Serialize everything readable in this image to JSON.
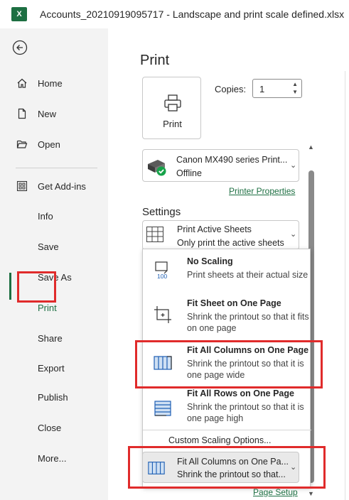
{
  "window": {
    "app_icon": "excel-icon",
    "app_icon_text": "X",
    "title": "Accounts_20210919095717 - Landscape and print scale defined.xlsx"
  },
  "sidebar": {
    "back_icon": "back-arrow-icon",
    "items": [
      {
        "label": "Home",
        "icon": "home-icon"
      },
      {
        "label": "New",
        "icon": "new-document-icon"
      },
      {
        "label": "Open",
        "icon": "folder-icon"
      },
      {
        "label": "Get Add-ins",
        "icon": "addins-grid-icon"
      },
      {
        "label": "Info"
      },
      {
        "label": "Save"
      },
      {
        "label": "Save As"
      },
      {
        "label": "Print",
        "selected": true
      },
      {
        "label": "Share"
      },
      {
        "label": "Export"
      },
      {
        "label": "Publish"
      },
      {
        "label": "Close"
      },
      {
        "label": "More..."
      }
    ]
  },
  "print": {
    "title": "Print",
    "print_button_label": "Print",
    "copies_label": "Copies:",
    "copies_value": "1",
    "printer": {
      "name": "Canon MX490 series Print...",
      "status": "Offline",
      "properties_link": "Printer Properties"
    },
    "settings_title": "Settings",
    "sheets_dropdown": {
      "title": "Print Active Sheets",
      "desc": "Only print the active sheets"
    },
    "scaling_menu": {
      "options": [
        {
          "title": "No Scaling",
          "desc": "Print sheets at their actual size",
          "icon": "no-scaling-icon",
          "icon_text": "100"
        },
        {
          "title": "Fit Sheet on One Page",
          "desc": "Shrink the printout so that it fits on one page",
          "icon": "fit-sheet-icon"
        },
        {
          "title": "Fit All Columns on One Page",
          "desc": "Shrink the printout so that it is one page wide",
          "icon": "fit-columns-icon"
        },
        {
          "title": "Fit All Rows on One Page",
          "desc": "Shrink the printout so that it is one page high",
          "icon": "fit-rows-icon"
        }
      ],
      "custom_label": "Custom Scaling Options..."
    },
    "scaling_dropdown": {
      "title": "Fit All Columns on One Pa...",
      "desc": "Shrink the printout so that..."
    },
    "page_setup_link": "Page Setup"
  },
  "colors": {
    "accent": "#1d6f42",
    "highlight_box": "#e02b2b"
  }
}
